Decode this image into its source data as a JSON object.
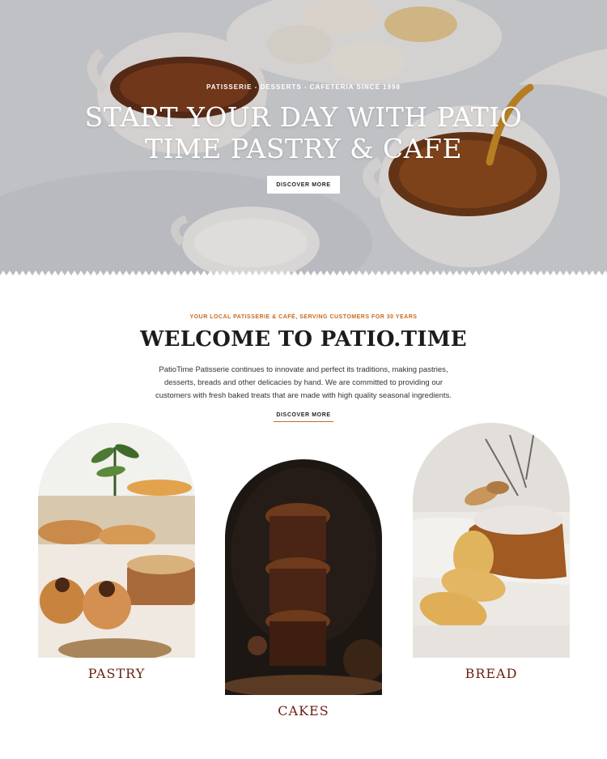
{
  "hero": {
    "eyebrow": "PATISSERIE - DESSERTS - CAFETERIA SINCE 1998",
    "title_line1": "START YOUR DAY WITH PATIO",
    "title_line2": "TIME PASTRY & CAFE",
    "button_label": "DISCOVER MORE"
  },
  "welcome": {
    "eyebrow": "YOUR LOCAL PATISSERIE & CAFÉ, SERVING CUSTOMERS FOR 30 YEARS",
    "title": "WELCOME TO PATIO.TIME",
    "body": "PatioTime Patisserie continues to innovate and perfect its traditions, making pastries, desserts, breads and other delicacies by hand. We are committed to providing our customers with fresh baked treats that are made with high quality seasonal ingredients.",
    "link_label": "DISCOVER MORE"
  },
  "categories": [
    {
      "label": "PASTRY"
    },
    {
      "label": "CAKES"
    },
    {
      "label": "BREAD"
    }
  ],
  "colors": {
    "accent": "#c8691e",
    "category_label": "#6b1e14"
  }
}
